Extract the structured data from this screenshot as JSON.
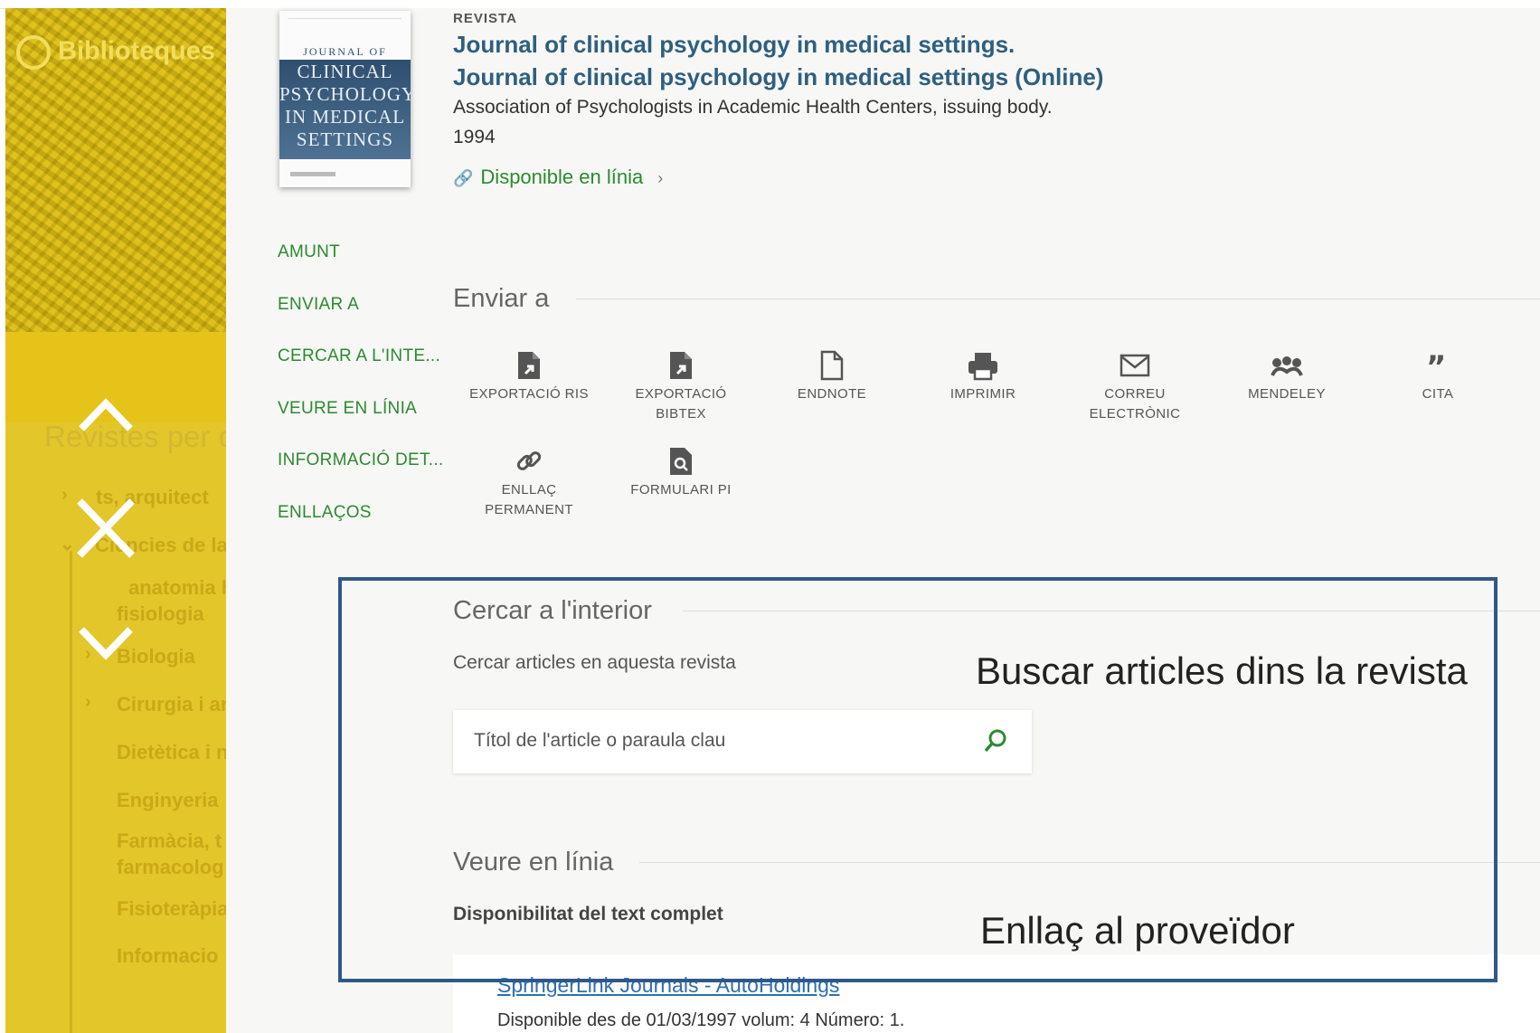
{
  "sidebar": {
    "library_name": "Biblioteques",
    "faded_heading": "Revistes per c",
    "faded_items": [
      "ts, arquitect",
      "Ciències de la",
      "anatomia h",
      "fisiologia",
      "Biologia",
      "Cirurgia i ar",
      "Dietètica i n",
      "Enginyeria",
      "Farmàcia, t",
      "farmacolog",
      "Fisioteràpia",
      "Informacio"
    ],
    "controls": [
      "chevron-up-icon",
      "close-icon",
      "chevron-down-icon"
    ]
  },
  "record": {
    "type": "REVISTA",
    "titles": [
      "Journal of clinical psychology in medical settings.",
      "Journal of clinical psychology in medical settings (Online)"
    ],
    "author": "Association of Psychologists in Academic Health Centers, issuing body.",
    "year": "1994",
    "availability": "Disponible en línia",
    "cover": {
      "line1": "JOURNAL OF",
      "line2": "CLINICAL PSYCHOLOGY IN MEDICAL SETTINGS"
    }
  },
  "nav": [
    "AMUNT",
    "ENVIAR A",
    "CERCAR A L'INTE...",
    "VEURE EN LÍNIA",
    "INFORMACIÓ DET...",
    "ENLLAÇOS"
  ],
  "send_to": {
    "title": "Enviar a",
    "actions": [
      {
        "label": "EXPORTACIÓ RIS",
        "icon": "export-ris-icon"
      },
      {
        "label": "EXPORTACIÓ BIBTEX",
        "icon": "export-bibtex-icon"
      },
      {
        "label": "ENDNOTE",
        "icon": "document-icon"
      },
      {
        "label": "IMPRIMIR",
        "icon": "printer-icon"
      },
      {
        "label": "CORREU ELECTRÒNIC",
        "icon": "mail-icon"
      },
      {
        "label": "MENDELEY",
        "icon": "mendeley-icon"
      },
      {
        "label": "CITA",
        "icon": "quote-icon"
      },
      {
        "label": "ENLLAÇ PERMANENT",
        "icon": "link-icon"
      },
      {
        "label": "FORMULARI PI",
        "icon": "document-search-icon"
      }
    ]
  },
  "search_inside": {
    "title": "Cercar a l'interior",
    "description": "Cercar articles en aquesta revista",
    "placeholder": "Títol de l'article o paraula clau"
  },
  "view_online": {
    "title": "Veure en línia",
    "subtitle": "Disponibilitat del text complet",
    "provider": "SpringerLink Journals - AutoHoldings",
    "coverage": "Disponible des de 01/03/1997 volum: 4 Número: 1."
  },
  "annotations": {
    "search_note": "Buscar articles dins la revista",
    "provider_note": "Enllaç al proveïdor"
  },
  "colors": {
    "sidebar": "#e2c21a",
    "link_green": "#2d8a2f",
    "title_blue": "#2f5f7f",
    "highlight_border": "#2f5889"
  }
}
